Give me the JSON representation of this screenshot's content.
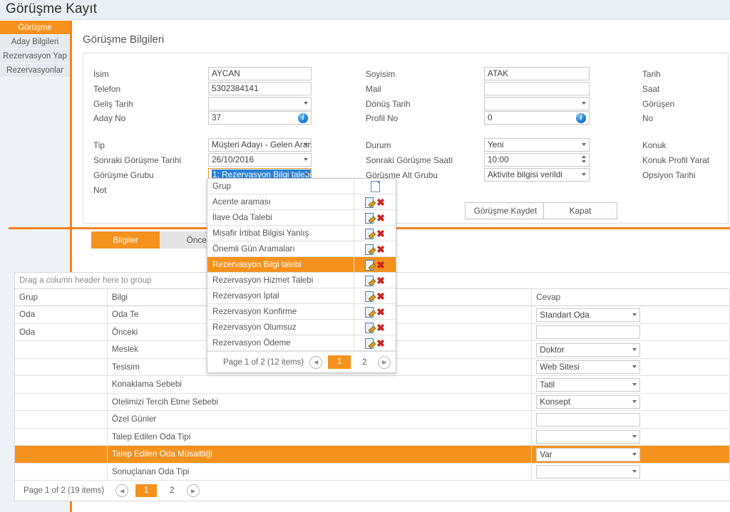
{
  "window": {
    "title": "Görüşme Kayıt"
  },
  "sidebar": {
    "items": [
      {
        "label": "Görüşme",
        "active": true
      },
      {
        "label": "Aday Bilgileri",
        "active": false
      },
      {
        "label": "Rezervasyon Yap",
        "active": false
      },
      {
        "label": "Rezervasyonlar",
        "active": false
      }
    ]
  },
  "section": {
    "title": "Görüşme Bilgileri"
  },
  "form": {
    "col1": [
      {
        "label": "İsim",
        "value": "AYCAN",
        "type": "text"
      },
      {
        "label": "Telefon",
        "value": "5302384141",
        "type": "text"
      },
      {
        "label": "Geliş Tarih",
        "value": "",
        "type": "select"
      },
      {
        "label": "Aday No",
        "value": "37",
        "type": "info"
      },
      {
        "label": "Tip",
        "value": "Müşteri Adayı -  Gelen Aram",
        "type": "select"
      },
      {
        "label": "Sonraki Görüşme Tarihi",
        "value": "26/10/2016",
        "type": "select"
      },
      {
        "label": "Görüşme Grubu",
        "value": "1; Rezervasyon Bilgi talebi",
        "type": "select-focused"
      },
      {
        "label": "Not",
        "value": "",
        "type": "none"
      }
    ],
    "col2": [
      {
        "label": "Soyisim",
        "value": "ATAK",
        "type": "text"
      },
      {
        "label": "Mail",
        "value": "",
        "type": "text"
      },
      {
        "label": "Dönüş Tarih",
        "value": "",
        "type": "select"
      },
      {
        "label": "Profil No",
        "value": "0",
        "type": "info"
      },
      {
        "label": "Durum",
        "value": "Yeni",
        "type": "select"
      },
      {
        "label": "Sonraki Görüşme Saati",
        "value": "10:00",
        "type": "spinner"
      },
      {
        "label": "Görüşme Alt Grubu",
        "value": "Aktivite bilgisi verildi",
        "type": "select"
      }
    ],
    "col3": [
      {
        "label": "Tarih"
      },
      {
        "label": "Saat"
      },
      {
        "label": "Görüşen"
      },
      {
        "label": "No"
      },
      {
        "label": "Konuk"
      },
      {
        "label": "Konuk Profil Yarat"
      },
      {
        "label": "Opsiyon Tarihi"
      }
    ]
  },
  "buttons": {
    "save": "Görüşme Kaydet",
    "close": "Kapat"
  },
  "tabs": [
    {
      "label": "Bilgiler",
      "active": true
    },
    {
      "label": "Önceki Gör",
      "active": false
    }
  ],
  "grid": {
    "group_hint": "Drag a column header here to group",
    "columns": [
      "Grup",
      "Bilgi",
      "Cevap"
    ],
    "rows": [
      {
        "grup": "Oda",
        "bilgi": "Oda Te",
        "cevap": "Standart Oda",
        "cevap_type": "select",
        "selected": false
      },
      {
        "grup": "Oda",
        "bilgi": "Önceki",
        "cevap": "",
        "cevap_type": "input",
        "selected": false
      },
      {
        "grup": "",
        "bilgi": "Meslek",
        "cevap": "Doktor",
        "cevap_type": "select",
        "selected": false
      },
      {
        "grup": "",
        "bilgi": "Tesisim",
        "cevap": "Web Sitesi",
        "cevap_type": "select",
        "selected": false
      },
      {
        "grup": "",
        "bilgi": "Konaklama Sebebi",
        "cevap": "Tatil",
        "cevap_type": "select",
        "selected": false
      },
      {
        "grup": "",
        "bilgi": "Otelimizi Tercih Etme Sebebi",
        "cevap": "Konsept",
        "cevap_type": "select",
        "selected": false
      },
      {
        "grup": "",
        "bilgi": "Özel Günler",
        "cevap": "",
        "cevap_type": "input",
        "selected": false
      },
      {
        "grup": "",
        "bilgi": "Talep Edilen Oda Tipi",
        "cevap": "",
        "cevap_type": "select",
        "selected": false
      },
      {
        "grup": "",
        "bilgi": "Talep Edilen Oda Müsaitliği",
        "cevap": "Var",
        "cevap_type": "select",
        "selected": true
      },
      {
        "grup": "",
        "bilgi": "Sonuçlanan Oda Tipi",
        "cevap": "",
        "cevap_type": "select",
        "selected": false
      }
    ],
    "pager": {
      "summary": "Page 1 of 2 (19 items)",
      "pages": [
        "1",
        "2"
      ],
      "current": "1"
    }
  },
  "dropdown": {
    "header": "Grup",
    "items": [
      {
        "label": "Acente araması",
        "selected": false
      },
      {
        "label": "İlave Oda Talebi",
        "selected": false
      },
      {
        "label": "Misafir İrtibat Bilgisi Yanlış",
        "selected": false
      },
      {
        "label": "Önemli Gün Aramaları",
        "selected": false
      },
      {
        "label": "Rezervasyon Bilgi talebi",
        "selected": true
      },
      {
        "label": "Rezervasyon Hizmet Talebi",
        "selected": false
      },
      {
        "label": "Rezervasyon İptal",
        "selected": false
      },
      {
        "label": "Rezervasyon Konfirme",
        "selected": false
      },
      {
        "label": "Rezervasyon Olumsuz",
        "selected": false
      },
      {
        "label": "Rezervasyon Ödeme",
        "selected": false
      }
    ],
    "pager": {
      "summary": "Page 1 of 2 (12 items)",
      "pages": [
        "1",
        "2"
      ],
      "current": "1"
    }
  },
  "theme": {
    "accent": "#F5921E",
    "accent_rule": "#F5821F",
    "titlebar_bg": "#EAEFF5",
    "sidebar_bg": "#E6E9EE"
  }
}
